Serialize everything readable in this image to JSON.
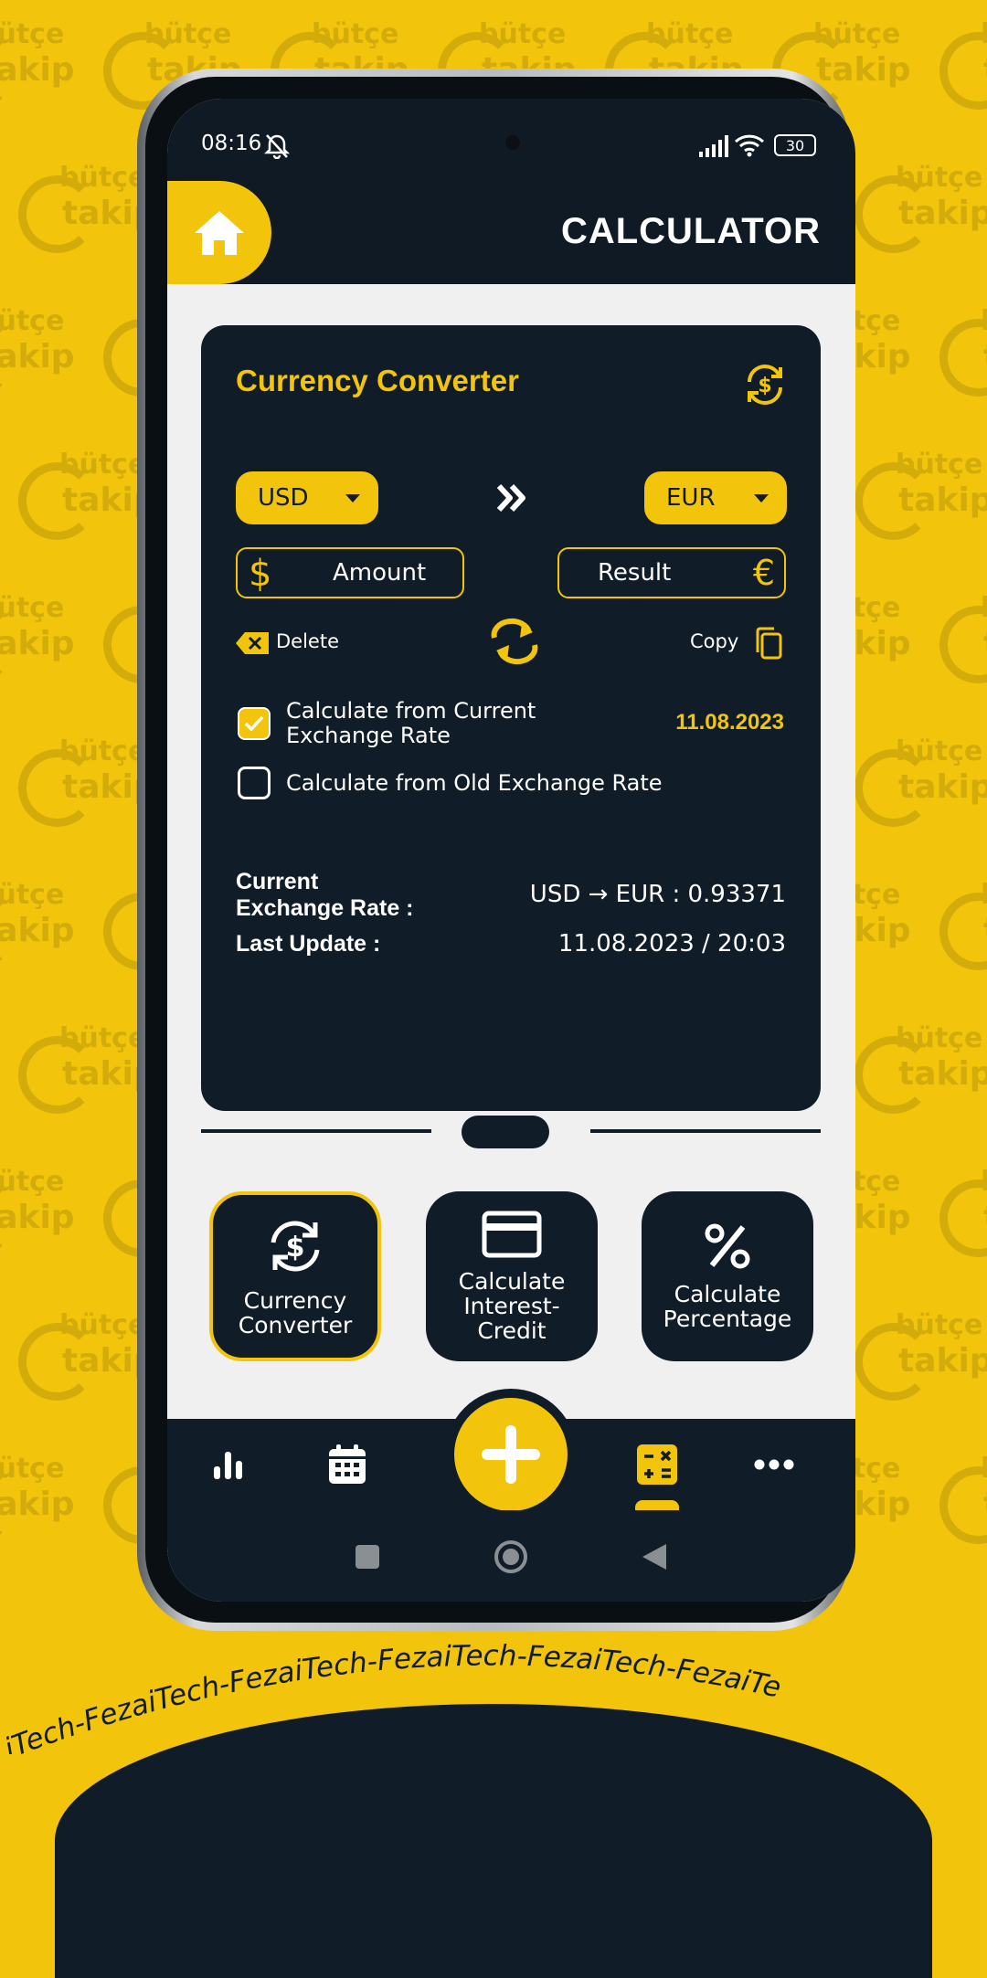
{
  "watermark": {
    "line1": "bütçe",
    "line2": "takip"
  },
  "branding_text": "iTech-FezaiTech-FezaiTech-FezaiTech-FezaiTech-FezaiTe",
  "statusbar": {
    "time": "08:16",
    "battery": "30"
  },
  "header": {
    "title": "CALCULATOR",
    "home_icon": "home-icon"
  },
  "converter": {
    "title": "Currency Converter",
    "from_currency": "USD",
    "to_currency": "EUR",
    "amount_placeholder": "Amount",
    "amount_symbol": "$",
    "result_placeholder": "Result",
    "result_symbol": "€",
    "delete_label": "Delete",
    "copy_label": "Copy",
    "option_current": "Calculate from Current Exchange Rate",
    "option_current_line1": "Calculate from Current",
    "option_current_line2": "Exchange Rate",
    "option_current_checked": true,
    "current_date": "11.08.2023",
    "option_old": "Calculate from Old Exchange Rate",
    "option_old_checked": false,
    "rate_label_line1": "Current",
    "rate_label_line2": "Exchange Rate :",
    "rate_value": "USD → EUR : 0.93371",
    "update_label": "Last Update :",
    "update_value": "11.08.2023 / 20:03"
  },
  "tiles": [
    {
      "line1": "Currency",
      "line2": "Converter",
      "active": true
    },
    {
      "line1": "Calculate",
      "line2": "Interest-",
      "line3": "Credit",
      "active": false
    },
    {
      "line1": "Calculate",
      "line2": "Percentage",
      "active": false
    }
  ],
  "colors": {
    "accent": "#f2c40c",
    "dark": "#101c27",
    "surface": "#f0f0f0"
  }
}
